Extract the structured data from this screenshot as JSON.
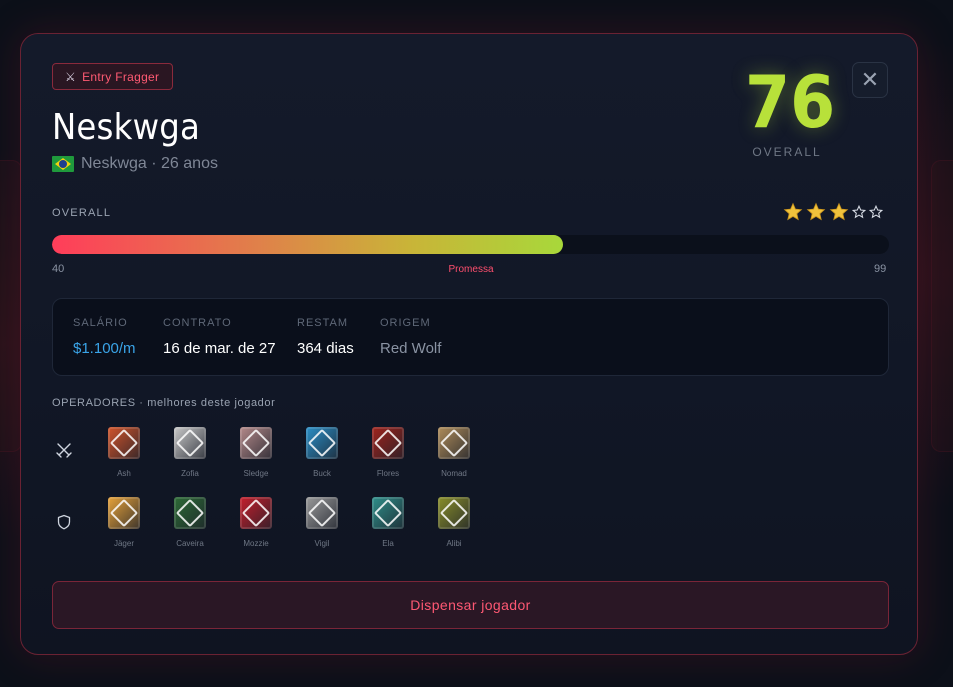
{
  "player": {
    "role": "Entry Fragger",
    "role_icon": "crossed-swords-icon",
    "name": "Neskwga",
    "subtitle": "Neskwga · 26 anos",
    "nationality_flag": "brazil-flag",
    "overall": "76",
    "overall_label": "OVERALL"
  },
  "rating": {
    "section_label": "OVERALL",
    "stars_filled": 3,
    "stars_total": 5,
    "min": "40",
    "max": "99",
    "value": 76,
    "tag": "Promessa"
  },
  "contract": {
    "salary_label": "SALÁRIO",
    "salary": "$1.100/m",
    "contract_label": "CONTRATO",
    "contract": "16 de mar. de 27",
    "remaining_label": "RESTAM",
    "remaining": "364 dias",
    "origin_label": "ORIGEM",
    "origin": "Red Wolf"
  },
  "operators": {
    "section_label": "OPERADORES · melhores deste jogador",
    "attack_icon": "crossed-swords-icon",
    "defense_icon": "shield-icon",
    "attackers": [
      {
        "name": "Ash",
        "color": "#d2542a"
      },
      {
        "name": "Zofia",
        "color": "#c9c9c9"
      },
      {
        "name": "Sledge",
        "color": "#b58a8a"
      },
      {
        "name": "Buck",
        "color": "#2b8fc7"
      },
      {
        "name": "Flores",
        "color": "#a0241d"
      },
      {
        "name": "Nomad",
        "color": "#b08d5a"
      }
    ],
    "defenders": [
      {
        "name": "Jäger",
        "color": "#e8a33a"
      },
      {
        "name": "Caveira",
        "color": "#2d6b36"
      },
      {
        "name": "Mozzie",
        "color": "#c61f2c"
      },
      {
        "name": "Vigil",
        "color": "#9a9a9a"
      },
      {
        "name": "Ela",
        "color": "#2f8f8a"
      },
      {
        "name": "Alibi",
        "color": "#8a8f2a"
      }
    ]
  },
  "actions": {
    "dismiss": "Dispensar jogador",
    "close_icon": "close-icon"
  }
}
